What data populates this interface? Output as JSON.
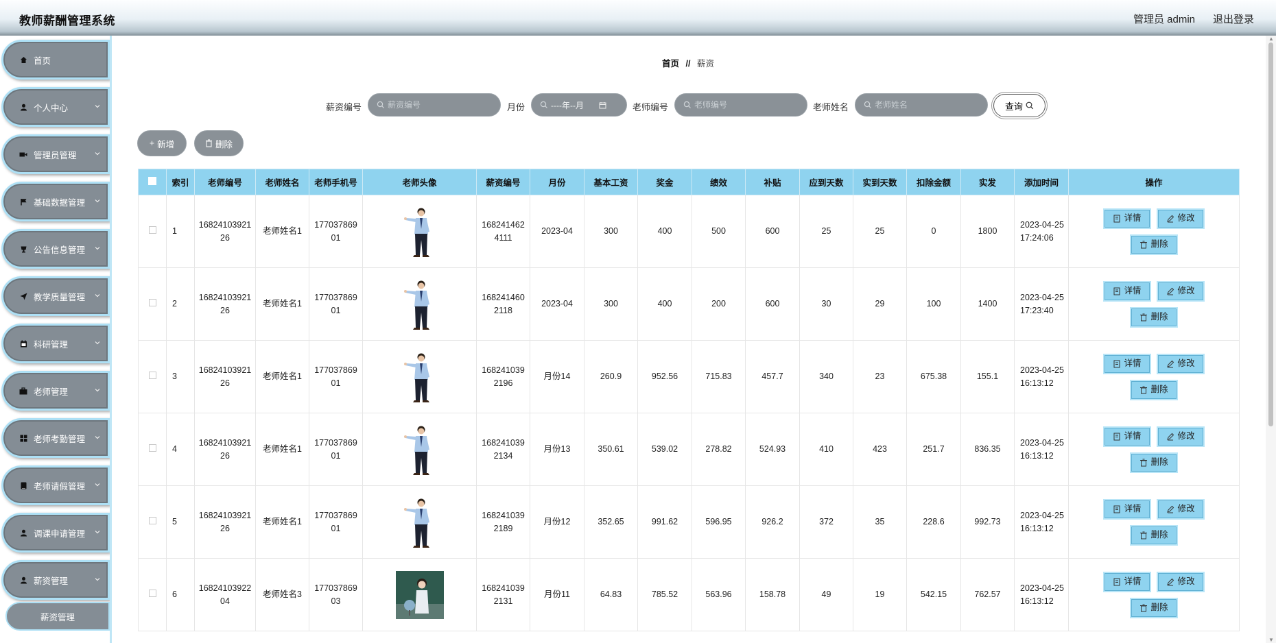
{
  "header": {
    "title": "教师薪酬管理系统",
    "user": "管理员 admin",
    "logout": "退出登录"
  },
  "sidebar": {
    "items": [
      {
        "label": "首页",
        "icon": "home-icon",
        "has_children": false
      },
      {
        "label": "个人中心",
        "icon": "user-icon",
        "has_children": true
      },
      {
        "label": "管理员管理",
        "icon": "video-icon",
        "has_children": true
      },
      {
        "label": "基础数据管理",
        "icon": "flag-icon",
        "has_children": true
      },
      {
        "label": "公告信息管理",
        "icon": "cup-icon",
        "has_children": true
      },
      {
        "label": "教学质量管理",
        "icon": "send-icon",
        "has_children": true
      },
      {
        "label": "科研管理",
        "icon": "calendar-icon",
        "has_children": true
      },
      {
        "label": "老师管理",
        "icon": "briefcase-icon",
        "has_children": true
      },
      {
        "label": "老师考勤管理",
        "icon": "grid-icon",
        "has_children": true
      },
      {
        "label": "老师请假管理",
        "icon": "document-icon",
        "has_children": true
      },
      {
        "label": "调课申请管理",
        "icon": "user-icon",
        "has_children": true
      },
      {
        "label": "薪资管理",
        "icon": "user-icon",
        "has_children": true
      }
    ],
    "active_sub": "薪资管理"
  },
  "breadcrumb": {
    "home": "首页",
    "sep": "//",
    "current": "薪资"
  },
  "search": {
    "salary_no_label": "薪资编号",
    "salary_no_placeholder": "薪资编号",
    "month_label": "月份",
    "month_value": "----年--月",
    "teacher_no_label": "老师编号",
    "teacher_no_placeholder": "老师编号",
    "teacher_name_label": "老师姓名",
    "teacher_name_placeholder": "老师姓名",
    "query": "查询"
  },
  "actions": {
    "add": "新增",
    "delete": "删除"
  },
  "table": {
    "columns": [
      "索引",
      "老师编号",
      "老师姓名",
      "老师手机号",
      "老师头像",
      "薪资编号",
      "月份",
      "基本工资",
      "奖金",
      "绩效",
      "补贴",
      "应到天数",
      "实到天数",
      "扣除金额",
      "实发",
      "添加时间",
      "操作"
    ],
    "ops": {
      "detail": "详情",
      "edit": "修改",
      "delete": "删除"
    },
    "rows": [
      {
        "idx": "1",
        "tno": "1682410392126",
        "tname": "老师姓名1",
        "phone": "17703786901",
        "avatar": "man",
        "sno": "1682414624111",
        "month": "2023-04",
        "base": "300",
        "bonus": "400",
        "perf": "500",
        "allow": "600",
        "due": "25",
        "actual": "25",
        "deduct": "0",
        "net": "1800",
        "time": "2023-04-25 17:24:06"
      },
      {
        "idx": "2",
        "tno": "1682410392126",
        "tname": "老师姓名1",
        "phone": "17703786901",
        "avatar": "man",
        "sno": "1682414602118",
        "month": "2023-04",
        "base": "300",
        "bonus": "400",
        "perf": "200",
        "allow": "600",
        "due": "30",
        "actual": "29",
        "deduct": "100",
        "net": "1400",
        "time": "2023-04-25 17:23:40"
      },
      {
        "idx": "3",
        "tno": "1682410392126",
        "tname": "老师姓名1",
        "phone": "17703786901",
        "avatar": "man",
        "sno": "1682410392196",
        "month": "月份14",
        "base": "260.9",
        "bonus": "952.56",
        "perf": "715.83",
        "allow": "457.7",
        "due": "340",
        "actual": "23",
        "deduct": "675.38",
        "net": "155.1",
        "time": "2023-04-25 16:13:12"
      },
      {
        "idx": "4",
        "tno": "1682410392126",
        "tname": "老师姓名1",
        "phone": "17703786901",
        "avatar": "man",
        "sno": "1682410392134",
        "month": "月份13",
        "base": "350.61",
        "bonus": "539.02",
        "perf": "278.82",
        "allow": "524.93",
        "due": "410",
        "actual": "423",
        "deduct": "251.7",
        "net": "836.35",
        "time": "2023-04-25 16:13:12"
      },
      {
        "idx": "5",
        "tno": "1682410392126",
        "tname": "老师姓名1",
        "phone": "17703786901",
        "avatar": "man",
        "sno": "1682410392189",
        "month": "月份12",
        "base": "352.65",
        "bonus": "991.62",
        "perf": "596.95",
        "allow": "926.2",
        "due": "372",
        "actual": "35",
        "deduct": "228.6",
        "net": "992.73",
        "time": "2023-04-25 16:13:12"
      },
      {
        "idx": "6",
        "tno": "1682410392204",
        "tname": "老师姓名3",
        "phone": "17703786903",
        "avatar": "woman",
        "sno": "1682410392131",
        "month": "月份11",
        "base": "64.83",
        "bonus": "785.52",
        "perf": "563.96",
        "allow": "158.78",
        "due": "49",
        "actual": "19",
        "deduct": "542.15",
        "net": "762.57",
        "time": "2023-04-25 16:13:12"
      }
    ]
  },
  "colors": {
    "menu_bg": "#848d95",
    "menu_border": "#aee0f5",
    "table_head": "#8fd3ef",
    "input_bg": "#8a9197"
  }
}
